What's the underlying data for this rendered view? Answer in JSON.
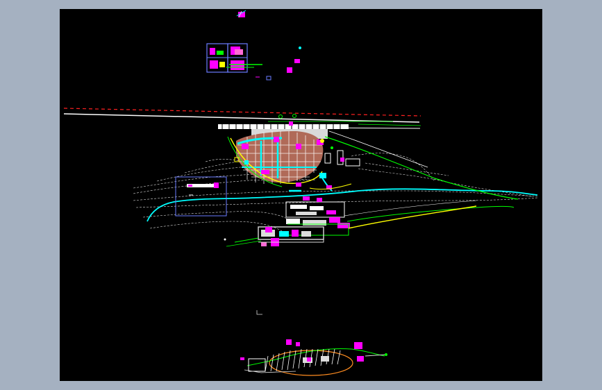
{
  "window": {
    "background": "#a5b1c1"
  },
  "canvas": {
    "background": "#000000"
  },
  "palette": {
    "magenta": "#ff00ff",
    "cyan": "#00ffff",
    "green": "#00ff00",
    "yellow": "#ffff00",
    "white": "#ffffff",
    "red": "#ff2020",
    "blue": "#6a7cff",
    "salmon": "#c07860",
    "orange": "#ff8c20"
  }
}
